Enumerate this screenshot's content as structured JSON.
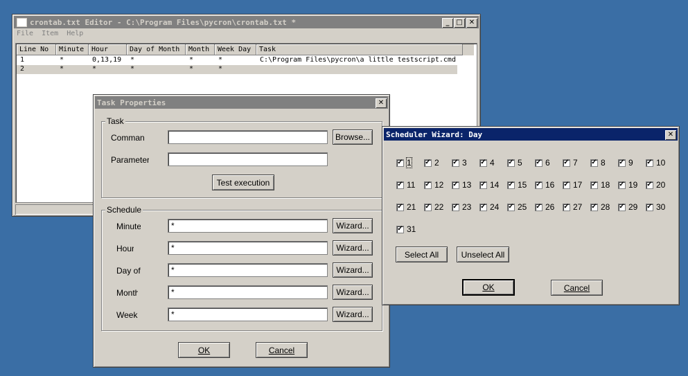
{
  "editor": {
    "title": "crontab.txt Editor - C:\\Program Files\\pycron\\crontab.txt *",
    "menu": [
      "File",
      "Item",
      "Help"
    ],
    "columns": [
      "Line No",
      "Minute",
      "Hour",
      "Day of Month",
      "Month",
      "Week Day",
      "Task"
    ],
    "rows": [
      [
        "1",
        "*",
        "0,13,19",
        "*",
        "*",
        "*",
        "C:\\Program Files\\pycron\\a little testscript.cmd"
      ],
      [
        "2",
        "*",
        "*",
        "*",
        "*",
        "*",
        ""
      ]
    ]
  },
  "task_props": {
    "title": "Task Properties",
    "task_group": "Task",
    "command_label": "Comman",
    "parameters_label": "Parameter",
    "browse_label": "Browse...",
    "test_label": "Test execution",
    "schedule_group": "Schedule",
    "rows": [
      {
        "label": "Minute",
        "value": "*",
        "wizard": "Wizard..."
      },
      {
        "label": "Hour",
        "value": "*",
        "wizard": "Wizard..."
      },
      {
        "label": "Day of",
        "value": "*",
        "wizard": "Wizard..."
      },
      {
        "label": "Month",
        "value": "*",
        "wizard": "Wizard..."
      },
      {
        "label": "Week",
        "value": "*",
        "wizard": "Wizard..."
      }
    ],
    "ok_label": "OK",
    "cancel_label": "Cancel"
  },
  "wizard": {
    "title": "Scheduler Wizard: Day",
    "days": [
      "1",
      "2",
      "3",
      "4",
      "5",
      "6",
      "7",
      "8",
      "9",
      "10",
      "11",
      "12",
      "13",
      "14",
      "15",
      "16",
      "17",
      "18",
      "19",
      "20",
      "21",
      "22",
      "23",
      "24",
      "25",
      "26",
      "27",
      "28",
      "29",
      "30",
      "31"
    ],
    "checked": true,
    "select_all_label": "Select All",
    "unselect_all_label": "Unselect All",
    "ok_label": "OK",
    "cancel_label": "Cancel"
  }
}
